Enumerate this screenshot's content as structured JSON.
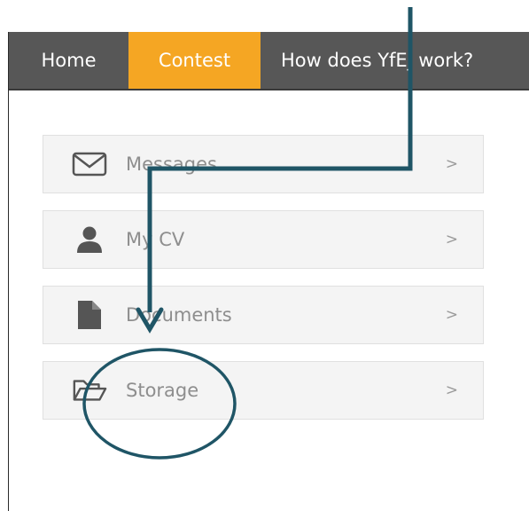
{
  "nav": {
    "tabs": [
      {
        "label": "Home",
        "active": false
      },
      {
        "label": "Contest",
        "active": true
      },
      {
        "label": "How does YfEj work?",
        "active": false
      }
    ],
    "active_color": "#f5a623",
    "bar_color": "#575757"
  },
  "menu": {
    "items": [
      {
        "label": "Messages",
        "icon": "envelope-icon",
        "chevron": ">"
      },
      {
        "label": "My CV",
        "icon": "user-icon",
        "chevron": ">"
      },
      {
        "label": "Documents",
        "icon": "document-icon",
        "chevron": ">"
      },
      {
        "label": "Storage",
        "icon": "folder-open-icon",
        "chevron": ">"
      }
    ]
  },
  "annotation": {
    "color": "#1f5566"
  }
}
